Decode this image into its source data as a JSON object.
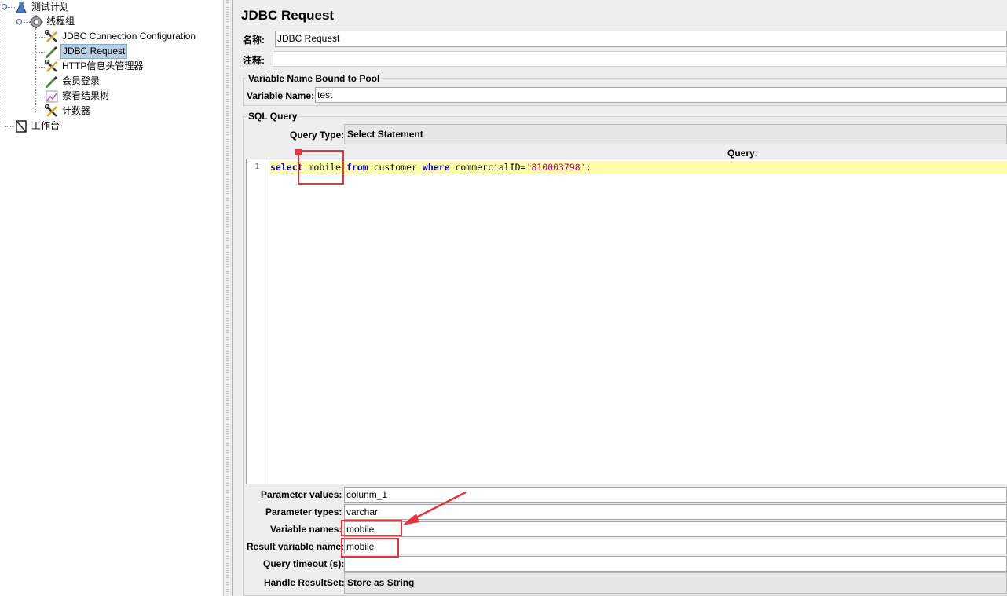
{
  "tree": {
    "test_plan": "测试计划",
    "thread_group": "线程组",
    "jdbc_config": "JDBC Connection Configuration",
    "jdbc_request": "JDBC Request",
    "http_header": "HTTP信息头管理器",
    "member_login": "会员登录",
    "view_results": "察看结果树",
    "counter": "计数器",
    "workbench": "工作台"
  },
  "panel": {
    "title": "JDBC Request",
    "name_label": "名称:",
    "name_value": "JDBC Request",
    "comment_label": "注释:",
    "comment_value": "",
    "pool_group_title": "Variable Name Bound to Pool",
    "variable_name_label": "Variable Name:",
    "variable_name_value": "test",
    "sql_group_title": "SQL Query",
    "query_type_label": "Query Type:",
    "query_type_value": "Select Statement",
    "query_label": "Query:",
    "line_number": "1",
    "code": {
      "kw_select": "select",
      "t1": " mobile ",
      "kw_from": "from",
      "t2": " customer ",
      "kw_where": "where",
      "t3": " commercialID=",
      "str_id": "'810003798'",
      "t4": ";"
    },
    "param_values_label": "Parameter values:",
    "param_values_value": "colunm_1",
    "param_types_label": "Parameter types:",
    "param_types_value": "varchar",
    "variable_names_label": "Variable names:",
    "variable_names_value": "mobile",
    "result_var_label": "Result variable name:",
    "result_var_value": "mobile",
    "timeout_label": "Query timeout (s):",
    "timeout_value": "",
    "handle_resultset_label": "Handle ResultSet:",
    "handle_resultset_value": "Store as String"
  },
  "colors": {
    "highlight_red": "#e8323c",
    "keyword_blue": "#0000cc",
    "string_magenta": "#c4007c",
    "current_line": "#ffffaa",
    "selection": "#b8cfe5"
  },
  "icons": {
    "test_plan": "flask-icon",
    "thread_group": "gear-icon",
    "jdbc_config": "wrench-screwdriver-icon",
    "jdbc_request": "pipette-sampler-icon",
    "http_header": "wrench-screwdriver-icon",
    "member_login": "pipette-sampler-icon",
    "view_results": "chart-listener-icon",
    "counter": "wrench-screwdriver-icon",
    "workbench": "notebook-icon"
  }
}
